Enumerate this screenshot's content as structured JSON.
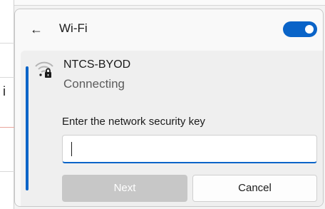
{
  "header": {
    "title": "Wi-Fi",
    "back_icon": "arrow-left-icon",
    "wifi_toggle_on": true
  },
  "network": {
    "name": "NTCS-BYOD",
    "status": "Connecting",
    "icon": "wifi-secured-icon"
  },
  "security": {
    "label": "Enter the network security key",
    "value": ""
  },
  "buttons": {
    "next": "Next",
    "cancel": "Cancel"
  },
  "background": {
    "partial_letter": "i"
  },
  "colors": {
    "accent": "#0a64c8",
    "disabled_button": "#c7c7c7"
  }
}
